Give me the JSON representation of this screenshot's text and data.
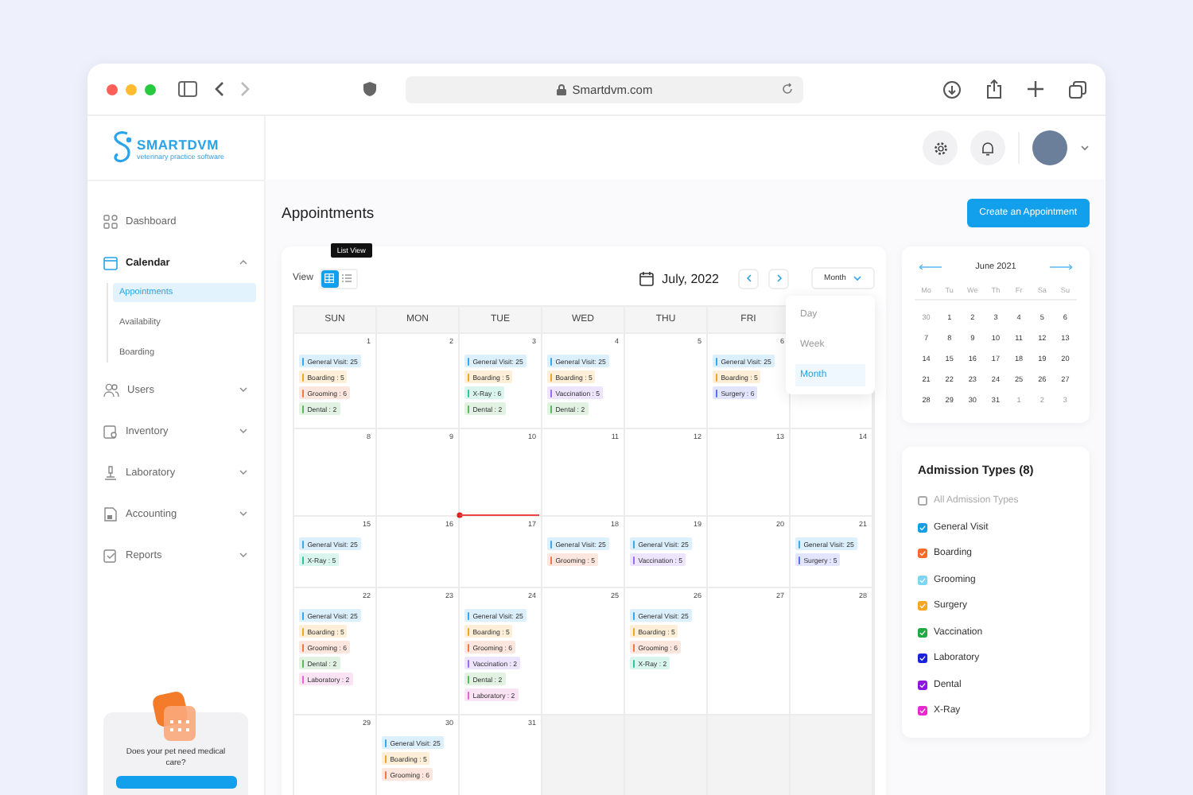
{
  "browser": {
    "url": "Smartdvm.com"
  },
  "brand": {
    "name": "SMARTDVM",
    "tagline": "veterinary practice software"
  },
  "sidebar": {
    "items": [
      {
        "kind": "dashboard",
        "label": "Dashboard"
      },
      {
        "kind": "calendar",
        "label": "Calendar",
        "expanded": true,
        "children": [
          {
            "label": "Appointments",
            "selected": true
          },
          {
            "label": "Availability",
            "selected": false
          },
          {
            "label": "Boarding",
            "selected": false
          }
        ]
      },
      {
        "kind": "users",
        "label": "Users",
        "expanded": false
      },
      {
        "kind": "inventory",
        "label": "Inventory",
        "expanded": false
      },
      {
        "kind": "laboratory",
        "label": "Laboratory",
        "expanded": false
      },
      {
        "kind": "accounting",
        "label": "Accounting",
        "expanded": false
      },
      {
        "kind": "reports",
        "label": "Reports",
        "expanded": false
      }
    ],
    "promo": {
      "text": "Does your pet need medical care?"
    }
  },
  "page": {
    "title": "Appointments",
    "create_button": "Create an Appointment"
  },
  "calendar": {
    "view_label": "View",
    "views": [
      {
        "kind": "grid",
        "selected": true
      },
      {
        "kind": "list",
        "selected": false
      }
    ],
    "tooltip": "List View",
    "period": "July, 2022",
    "mode": "Month",
    "mode_menu": [
      {
        "label": "Day",
        "selected": false
      },
      {
        "label": "Week",
        "selected": false
      },
      {
        "label": "Month",
        "selected": true
      }
    ],
    "weekdays": [
      "SUN",
      "MON",
      "TUE",
      "WED",
      "THU",
      "FRI"
    ],
    "weeks": [
      {
        "days": [
          {
            "date": "1",
            "outside": false,
            "events": [
              {
                "label": "General Visit: 25",
                "color": "#3aa8ec"
              },
              {
                "label": "Boarding : 5",
                "color": "#f5a623"
              },
              {
                "label": "Grooming : 6",
                "color": "#f2774a"
              },
              {
                "label": "Dental : 2",
                "color": "#5cb85c"
              }
            ]
          },
          {
            "date": "2",
            "outside": false
          },
          {
            "date": "3",
            "outside": false,
            "events": [
              {
                "label": "General Visit: 25",
                "color": "#3aa8ec"
              },
              {
                "label": "Boarding : 5",
                "color": "#f5a623"
              },
              {
                "label": "X-Ray : 6",
                "color": "#2cc79f"
              },
              {
                "label": "Dental : 2",
                "color": "#5cb85c"
              }
            ]
          },
          {
            "date": "4",
            "outside": false,
            "events": [
              {
                "label": "General Visit: 25",
                "color": "#3aa8ec"
              },
              {
                "label": "Boarding : 5",
                "color": "#f5a623"
              },
              {
                "label": "Vaccination : 5",
                "color": "#9b6cf2"
              },
              {
                "label": "Dental : 2",
                "color": "#5cb85c"
              }
            ]
          },
          {
            "date": "5",
            "outside": false
          },
          {
            "date": "6",
            "outside": false,
            "events": [
              {
                "label": "General Visit: 25",
                "color": "#3aa8ec"
              },
              {
                "label": "Boarding : 5",
                "color": "#f5a623"
              },
              {
                "label": "Surgery : 6",
                "color": "#5c6ff2"
              }
            ]
          },
          {
            "outside": false
          }
        ]
      },
      {
        "days": [
          {
            "date": "8",
            "outside": false
          },
          {
            "date": "9",
            "outside": false
          },
          {
            "date": "10",
            "outside": false
          },
          {
            "date": "11",
            "outside": false
          },
          {
            "date": "12",
            "outside": false
          },
          {
            "date": "13",
            "outside": false
          },
          {
            "date": "14",
            "outside": false
          }
        ]
      },
      {
        "days": [
          {
            "date": "15",
            "outside": false,
            "events": [
              {
                "label": "General Visit: 25",
                "color": "#3aa8ec"
              },
              {
                "label": "X-Ray : 5",
                "color": "#2cc79f"
              }
            ]
          },
          {
            "date": "16",
            "outside": false
          },
          {
            "date": "17",
            "outside": false
          },
          {
            "date": "18",
            "outside": false,
            "events": [
              {
                "label": "General Visit: 25",
                "color": "#3aa8ec"
              },
              {
                "label": "Grooming : 5",
                "color": "#f2774a"
              }
            ]
          },
          {
            "date": "19",
            "outside": false,
            "events": [
              {
                "label": "General Visit: 25",
                "color": "#3aa8ec"
              },
              {
                "label": "Vaccination : 5",
                "color": "#9b6cf2"
              }
            ]
          },
          {
            "date": "20",
            "outside": false
          },
          {
            "date": "21",
            "outside": false,
            "events": [
              {
                "label": "General Visit: 25",
                "color": "#3aa8ec"
              },
              {
                "label": "Surgery : 5",
                "color": "#5c6ff2"
              }
            ]
          }
        ]
      },
      {
        "days": [
          {
            "date": "22",
            "outside": false,
            "events": [
              {
                "label": "General Visit: 25",
                "color": "#3aa8ec"
              },
              {
                "label": "Boarding : 5",
                "color": "#f5a623"
              },
              {
                "label": "Grooming : 6",
                "color": "#f2774a"
              },
              {
                "label": "Dental : 2",
                "color": "#5cb85c"
              },
              {
                "label": "Laboratory : 2",
                "color": "#ea62cf"
              }
            ]
          },
          {
            "date": "23",
            "outside": false
          },
          {
            "date": "24",
            "outside": false,
            "events": [
              {
                "label": "General Visit: 25",
                "color": "#3aa8ec"
              },
              {
                "label": "Boarding : 5",
                "color": "#f5a623"
              },
              {
                "label": "Grooming : 6",
                "color": "#f2774a"
              },
              {
                "label": "Vaccination : 2",
                "color": "#9b6cf2"
              },
              {
                "label": "Dental : 2",
                "color": "#5cb85c"
              },
              {
                "label": "Laboratory : 2",
                "color": "#ea62cf"
              }
            ]
          },
          {
            "date": "25",
            "outside": false
          },
          {
            "date": "26",
            "outside": false,
            "events": [
              {
                "label": "General Visit: 25",
                "color": "#3aa8ec"
              },
              {
                "label": "Boarding : 5",
                "color": "#f5a623"
              },
              {
                "label": "Grooming : 6",
                "color": "#f2774a"
              },
              {
                "label": "X-Ray : 2",
                "color": "#2cc79f"
              }
            ]
          },
          {
            "date": "27",
            "outside": false
          },
          {
            "date": "28",
            "outside": false
          }
        ]
      },
      {
        "days": [
          {
            "date": "29",
            "outside": false
          },
          {
            "date": "30",
            "outside": false,
            "events": [
              {
                "label": "General Visit: 25",
                "color": "#3aa8ec"
              },
              {
                "label": "Boarding : 5",
                "color": "#f5a623"
              },
              {
                "label": "Grooming : 6",
                "color": "#f2774a"
              }
            ]
          },
          {
            "date": "31",
            "outside": false
          },
          {
            "outside": true
          },
          {
            "outside": true
          },
          {
            "outside": true
          },
          {
            "outside": true
          }
        ]
      }
    ]
  },
  "mini_calendar": {
    "title": "June 2021",
    "weekdays": [
      "Mo",
      "Tu",
      "We",
      "Th",
      "Fr",
      "Sa",
      "Su"
    ],
    "weeks": [
      [
        {
          "d": "30",
          "muted": true
        },
        {
          "d": "1",
          "muted": false
        },
        {
          "d": "2",
          "muted": false
        },
        {
          "d": "3",
          "muted": false
        },
        {
          "d": "4",
          "muted": false
        },
        {
          "d": "5",
          "muted": false
        },
        {
          "d": "6",
          "muted": false
        }
      ],
      [
        {
          "d": "7",
          "muted": false
        },
        {
          "d": "8",
          "muted": false
        },
        {
          "d": "9",
          "muted": false
        },
        {
          "d": "10",
          "muted": false
        },
        {
          "d": "11",
          "muted": false
        },
        {
          "d": "12",
          "muted": false
        },
        {
          "d": "13",
          "muted": false
        }
      ],
      [
        {
          "d": "14",
          "muted": false
        },
        {
          "d": "15",
          "muted": false
        },
        {
          "d": "16",
          "muted": false
        },
        {
          "d": "17",
          "muted": false
        },
        {
          "d": "18",
          "muted": false
        },
        {
          "d": "19",
          "muted": false
        },
        {
          "d": "20",
          "muted": false
        }
      ],
      [
        {
          "d": "21",
          "muted": false
        },
        {
          "d": "22",
          "muted": false
        },
        {
          "d": "23",
          "muted": false
        },
        {
          "d": "24",
          "muted": false
        },
        {
          "d": "25",
          "muted": false
        },
        {
          "d": "26",
          "muted": false
        },
        {
          "d": "27",
          "muted": false
        }
      ],
      [
        {
          "d": "28",
          "muted": false
        },
        {
          "d": "29",
          "muted": false
        },
        {
          "d": "30",
          "muted": false
        },
        {
          "d": "31",
          "muted": false
        },
        {
          "d": "1",
          "muted": true
        },
        {
          "d": "2",
          "muted": true
        },
        {
          "d": "3",
          "muted": true
        }
      ]
    ]
  },
  "admission_types": {
    "title": "Admission Types (8)",
    "all": {
      "label": "All Admission Types",
      "checked": false
    },
    "items": [
      {
        "label": "General Visit",
        "checked": true,
        "color": "#1a9be6"
      },
      {
        "label": "Boarding",
        "checked": true,
        "color": "#f26b2a"
      },
      {
        "label": "Grooming",
        "checked": true,
        "color": "#7fd3f5"
      },
      {
        "label": "Surgery",
        "checked": true,
        "color": "#f5a623"
      },
      {
        "label": "Vaccination",
        "checked": true,
        "color": "#22a845"
      },
      {
        "label": "Laboratory",
        "checked": true,
        "color": "#1a22d6"
      },
      {
        "label": "Dental",
        "checked": true,
        "color": "#8a16e0"
      },
      {
        "label": "X-Ray",
        "checked": true,
        "color": "#e62ad0"
      }
    ]
  }
}
